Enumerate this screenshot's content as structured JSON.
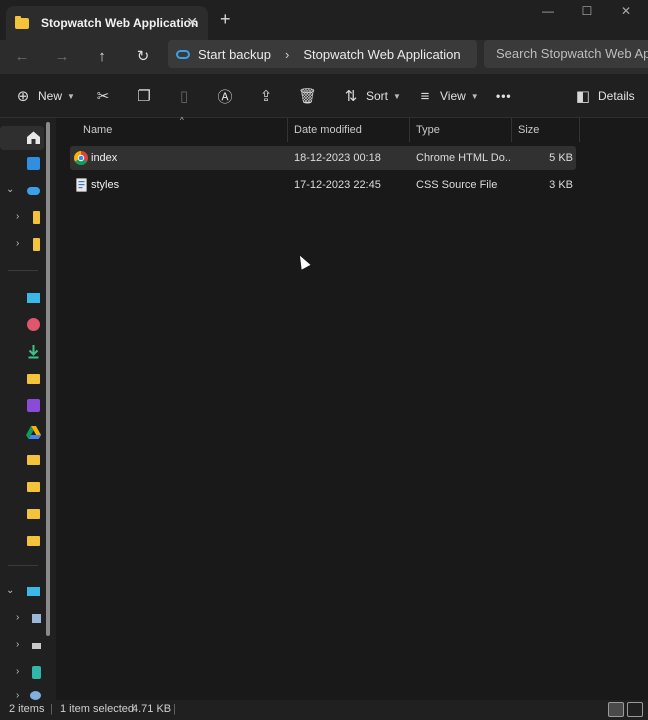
{
  "window": {
    "tab_title": "Stopwatch Web Application",
    "tab_close": "✕",
    "new_tab": "+",
    "minimize": "—",
    "maximize": "☐",
    "close": "✕"
  },
  "navigation": {
    "back": "←",
    "forward": "→",
    "up": "↑",
    "refresh": "↻",
    "breadcrumb": [
      "Start backup",
      "Stopwatch Web Application"
    ],
    "separator": "›",
    "search_placeholder": "Search Stopwatch Web Application"
  },
  "toolbar": {
    "new_label": "New",
    "sort_label": "Sort",
    "view_label": "View",
    "more_label": "•••",
    "details_label": "Details"
  },
  "columns": {
    "name": "Name",
    "date_modified": "Date modified",
    "type": "Type",
    "size": "Size"
  },
  "files": [
    {
      "name": "index",
      "date": "18-12-2023 00:18",
      "type": "Chrome HTML Do...",
      "size": "5 KB",
      "icon": "chrome-icon",
      "selected": true
    },
    {
      "name": "styles",
      "date": "17-12-2023 22:45",
      "type": "CSS Source File",
      "size": "3 KB",
      "icon": "css-file-icon",
      "selected": false
    }
  ],
  "status": {
    "item_count": "2 items",
    "selection": "1 item selected",
    "selection_size": "4.71 KB"
  },
  "colors": {
    "folder": "#f3c33b",
    "onedrive": "#3aa0e8",
    "selection": "#313131",
    "background": "#191919"
  }
}
